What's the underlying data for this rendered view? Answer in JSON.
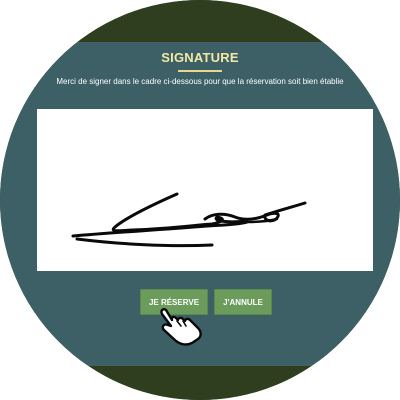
{
  "dialog": {
    "title": "SIGNATURE",
    "instruction": "Merci de signer dans le cadre ci-dessous pour que la réservation soit bien établie"
  },
  "buttons": {
    "reserve_label": "JE RÉSERVE",
    "cancel_label": "J'ANNULE"
  },
  "icons": {
    "cursor": "hand-pointer-icon"
  },
  "colors": {
    "panel": "#3d5f66",
    "title": "#f3e9a6",
    "button": "#6b9c5c",
    "frame": "#2e3e1e"
  }
}
